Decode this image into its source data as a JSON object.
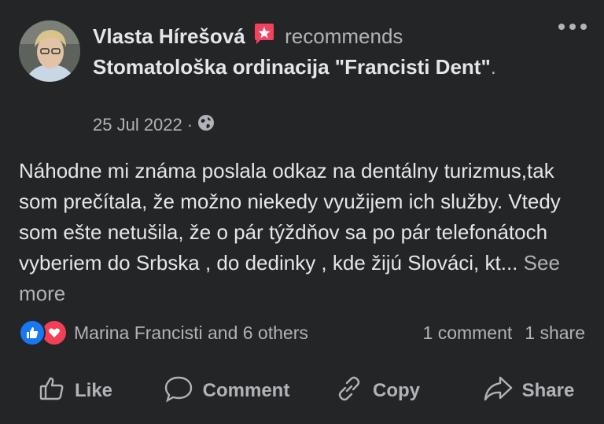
{
  "post": {
    "author": "Vlasta Hírešová",
    "verb": "recommends",
    "page_name": "Stomatološka ordinacija \"Francisti Dent\"",
    "trailing_period": ".",
    "date": "25 Jul 2022",
    "separator": "·",
    "audience_icon": "globe-icon",
    "body": "Náhodne  mi známa poslala odkaz na dentálny turizmus,tak som prečítala, že možno niekedy využijem ich služby.  Vtedy som ešte netušila, že o pár týždňov sa po pár telefonátoch vyberiem do Srbska , do dedinky , kde žijú Slováci, kt...",
    "see_more": "See more"
  },
  "reactions": {
    "icons": [
      "like-icon",
      "love-icon"
    ],
    "summary": "Marina Francisti and 6 others",
    "comments": "1 comment",
    "shares": "1 share"
  },
  "actions": {
    "like": "Like",
    "comment": "Comment",
    "copy": "Copy",
    "share": "Share"
  },
  "colors": {
    "background": "#242526",
    "primary_text": "#e4e6eb",
    "secondary_text": "#b0b3b8",
    "like_blue": "#1877f2",
    "love_red": "#f33e58",
    "recommend_badge": "#f3425f"
  }
}
